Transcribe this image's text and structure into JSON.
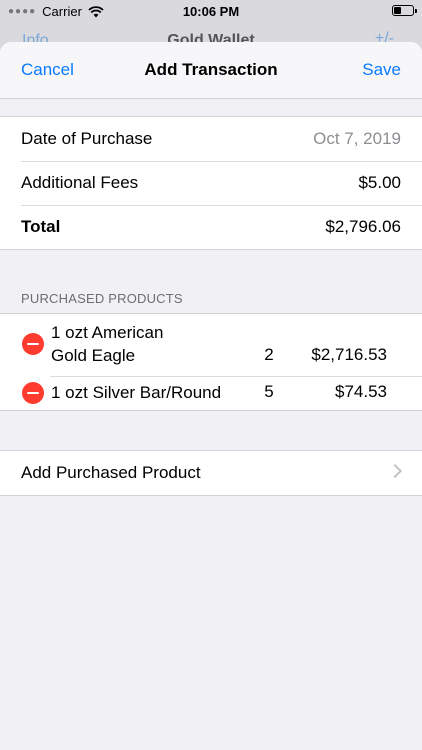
{
  "status_bar": {
    "carrier": "Carrier",
    "time": "10:06 PM"
  },
  "background_screen": {
    "left": "Info",
    "title": "Gold Wallet",
    "right": "+/-"
  },
  "navbar": {
    "cancel_label": "Cancel",
    "title": "Add Transaction",
    "save_label": "Save"
  },
  "details": {
    "date_label": "Date of Purchase",
    "date_value": "Oct 7, 2019",
    "fees_label": "Additional Fees",
    "fees_value": "$5.00",
    "total_label": "Total",
    "total_value": "$2,796.06"
  },
  "products": {
    "header": "PURCHASED PRODUCTS",
    "items": [
      {
        "name_line1": "1 ozt American",
        "name_line2": "Gold Eagle",
        "qty": "2",
        "price": "$2,716.53"
      },
      {
        "name_line1": "1 ozt Silver Bar/Round",
        "qty": "5",
        "price": "$74.53"
      }
    ]
  },
  "add_product_label": "Add Purchased Product",
  "colors": {
    "accent": "#0a7aff",
    "delete": "#ff3b30",
    "background": "#f1f1f5"
  }
}
